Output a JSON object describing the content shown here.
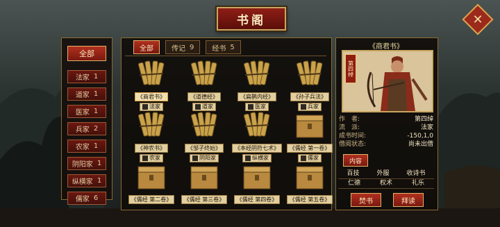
{
  "header": {
    "title": "书阁",
    "close_glyph": "✕"
  },
  "filters": {
    "all_label": "全部",
    "schools": [
      {
        "name": "法家",
        "count": "1"
      },
      {
        "name": "道家",
        "count": "1"
      },
      {
        "name": "医家",
        "count": "1"
      },
      {
        "name": "兵家",
        "count": "2"
      },
      {
        "name": "农家",
        "count": "1"
      },
      {
        "name": "阴阳家",
        "count": "1"
      },
      {
        "name": "纵横家",
        "count": "1"
      },
      {
        "name": "儒家",
        "count": "6"
      }
    ]
  },
  "tabs": [
    {
      "label": "全部",
      "count": ""
    },
    {
      "label": "传记",
      "count": "9"
    },
    {
      "label": "经书",
      "count": "5"
    }
  ],
  "books": [
    {
      "title": "《商君书》",
      "school": "法家",
      "icon": "bamboo-scroll-icon"
    },
    {
      "title": "《道德经》",
      "school": "道家",
      "icon": "bamboo-scroll-icon"
    },
    {
      "title": "《扁鹊内经》",
      "school": "医家",
      "icon": "bamboo-scroll-icon"
    },
    {
      "title": "《孙子兵法》",
      "school": "兵家",
      "icon": "bamboo-scroll-icon"
    },
    {
      "title": "《神农书》",
      "school": "农家",
      "icon": "bamboo-scroll-icon"
    },
    {
      "title": "《邹子终始》",
      "school": "阴阳家",
      "icon": "bamboo-scroll-icon"
    },
    {
      "title": "《本经阴符七术》",
      "school": "纵横家",
      "icon": "bamboo-scroll-icon"
    },
    {
      "title": "《儒经 第一卷》",
      "school": "儒家",
      "icon": "chest-icon"
    },
    {
      "title": "《儒经 第二卷》",
      "school": "",
      "icon": "chest-icon"
    },
    {
      "title": "《儒经 第三卷》",
      "school": "",
      "icon": "chest-icon"
    },
    {
      "title": "《儒经 第四卷》",
      "school": "",
      "icon": "chest-icon"
    },
    {
      "title": "《儒经 第五卷》",
      "school": "",
      "icon": "chest-icon"
    }
  ],
  "detail": {
    "title": "《商君书》",
    "rank": "第四绰",
    "info": [
      {
        "k": "作　者:",
        "v": "第四绰"
      },
      {
        "k": "流　派:",
        "v": "法家"
      },
      {
        "k": "成书时间:",
        "v": "-150,1,0"
      },
      {
        "k": "借阅状态:",
        "v": "尚未出借"
      }
    ],
    "effect_label": "内容",
    "effects": [
      [
        "百技",
        "外服",
        "收诗书"
      ],
      [
        "仁德",
        "权术",
        "礼乐"
      ]
    ],
    "burn_label": "焚书",
    "read_label": "拜读"
  }
}
